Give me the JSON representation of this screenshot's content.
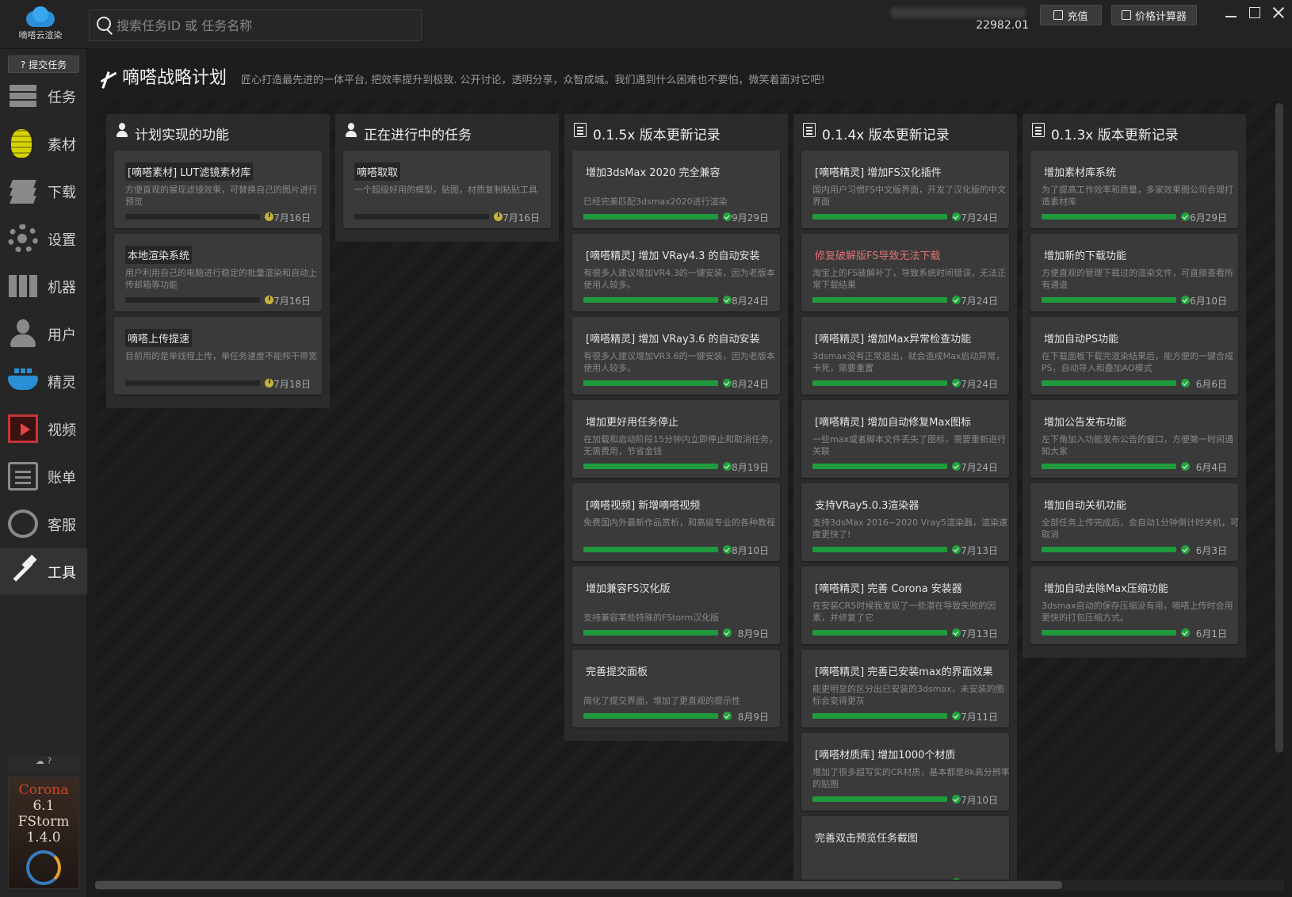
{
  "app": {
    "logo_text": "嘀嗒云渲染"
  },
  "search": {
    "placeholder": "搜索任务ID 或 任务名称"
  },
  "account": {
    "balance_suffix": "22982.01"
  },
  "toolbar": {
    "recharge": "充值",
    "calculator": "价格计算器"
  },
  "sidebar": {
    "submit": "? 提交任务",
    "items": [
      {
        "label": "任务",
        "icon": "bars-icon"
      },
      {
        "label": "素材",
        "icon": "grenade-icon"
      },
      {
        "label": "下载",
        "icon": "layers-icon"
      },
      {
        "label": "设置",
        "icon": "gear-icon"
      },
      {
        "label": "机器",
        "icon": "machine-icon"
      },
      {
        "label": "用户",
        "icon": "user-icon"
      },
      {
        "label": "精灵",
        "icon": "whale-icon"
      },
      {
        "label": "视频",
        "icon": "video-icon"
      },
      {
        "label": "账单",
        "icon": "bill-icon"
      },
      {
        "label": "客服",
        "icon": "headset-icon"
      },
      {
        "label": "工具",
        "icon": "hammer-icon",
        "active": true
      }
    ],
    "cloud_status": "☁ ?",
    "promo": {
      "line1": "Corona",
      "line2": "6.1",
      "line3": "FStorm",
      "line4": "1.4.0"
    }
  },
  "header": {
    "title": "嘀嗒战略计划",
    "subtitle": "匠心打造最先进的一体平台, 把效率提升到极致. 公开讨论，透明分享，众智成城。我们遇到什么困难也不要怕，微笑着面对它吧!"
  },
  "columns": [
    {
      "title": "计划实现的功能",
      "icon": "person-icon",
      "cards": [
        {
          "title": "[嘀嗒素材] LUT滤镜素材库",
          "tag": true,
          "desc": "方便直观的展现滤镜效果，可替换自己的图片进行预览",
          "progress": 0,
          "status": "plan",
          "date": "7月16日"
        },
        {
          "title": "本地渲染系统",
          "tag": true,
          "desc": "用户利用自己的电脑进行稳定的批量渲染和自动上传邮箱等功能",
          "progress": 0,
          "status": "plan",
          "date": "7月16日"
        },
        {
          "title": "嘀嗒上传提速",
          "tag": true,
          "desc": "目前用的是单线程上传，单任务速度不能榨干带宽",
          "progress": 0,
          "status": "plan",
          "date": "7月18日"
        }
      ]
    },
    {
      "title": "正在进行中的任务",
      "icon": "person-icon",
      "cards": [
        {
          "title": "嘀嗒取取",
          "tag": true,
          "desc": "一个超级好用的模型，贴图，材质复制粘贴工具",
          "progress": 0,
          "status": "plan",
          "date": "7月16日"
        }
      ]
    },
    {
      "title": "0.1.5x 版本更新记录",
      "icon": "doc-icon",
      "cards": [
        {
          "title": "增加3dsMax 2020 完全兼容",
          "desc": "已经完美匹配3dsmax2020进行渲染",
          "low": true,
          "progress": 100,
          "status": "done",
          "date": "9月29日"
        },
        {
          "title": "[嘀嗒精灵] 增加 VRay4.3 的自动安装",
          "desc": "有很多人建议增加VR4.3的一键安装，因为老版本使用人较多。",
          "progress": 100,
          "status": "done",
          "date": "8月24日"
        },
        {
          "title": "[嘀嗒精灵] 增加 VRay3.6 的自动安装",
          "desc": "有很多人建议增加VR3.6的一键安装，因为老版本使用人较多。",
          "progress": 100,
          "status": "done",
          "date": "8月24日"
        },
        {
          "title": "增加更好用任务停止",
          "desc": "在加载和启动阶段15分钟内立即停止和取消任务，无需费用，节省金钱",
          "progress": 100,
          "status": "done",
          "date": "8月19日"
        },
        {
          "title": "[嘀嗒视频] 新增嘀嗒视频",
          "desc": "免费国内外最新作品赏析，和高级专业的各种教程",
          "progress": 100,
          "status": "done",
          "date": "8月10日"
        },
        {
          "title": "增加兼容FS汉化版",
          "desc": "支持兼容某些特殊的FStorm汉化版",
          "low": true,
          "progress": 100,
          "status": "done",
          "date": "8月9日"
        },
        {
          "title": "完善提交面板",
          "desc": "简化了提交界面，增加了更直观的提示性",
          "low": true,
          "progress": 100,
          "status": "done",
          "date": "8月9日"
        }
      ]
    },
    {
      "title": "0.1.4x 版本更新记录",
      "icon": "doc-icon",
      "cards": [
        {
          "title": "[嘀嗒精灵] 增加FS汉化插件",
          "desc": "国内用户习惯FS中文版界面，开发了汉化版的中文界面",
          "progress": 100,
          "status": "done",
          "date": "7月24日"
        },
        {
          "title": "修复破解版FS导致无法下载",
          "red": true,
          "desc": "淘宝上的FS破解补丁，导致系统时间错误，无法正常下载结果",
          "progress": 100,
          "status": "done",
          "date": "7月24日"
        },
        {
          "title": "[嘀嗒精灵] 增加Max异常检查功能",
          "desc": "3dsmax没有正常退出，就会造成Max启动异常，卡死，需要重置",
          "progress": 100,
          "status": "done",
          "date": "7月24日"
        },
        {
          "title": "[嘀嗒精灵] 增加自动修复Max图标",
          "desc": "一些max或者脚本文件丢失了图标，需要重新进行关联",
          "progress": 100,
          "status": "done",
          "date": "7月24日"
        },
        {
          "title": "支持VRay5.0.3渲染器",
          "desc": "支持3dsMax 2016~2020 Vray5渲染器，渲染速度更快了!",
          "progress": 100,
          "status": "done",
          "date": "7月13日"
        },
        {
          "title": "[嘀嗒精灵] 完善 Corona 安装器",
          "desc": "在安装CR5时候我发现了一些潜在导致失败的因素，并修复了它",
          "progress": 100,
          "status": "done",
          "date": "7月13日"
        },
        {
          "title": "[嘀嗒精灵] 完善已安装max的界面效果",
          "desc": "能更明显的区分出已安装的3dsmax，未安装的图标会变得更灰",
          "progress": 100,
          "status": "done",
          "date": "7月11日"
        },
        {
          "title": "[嘀嗒材质库] 增加1000个材质",
          "desc": "增加了很多超写实的CR材质，基本都是8k高分辨率的贴图",
          "progress": 100,
          "status": "done",
          "date": "7月10日"
        },
        {
          "title": "完善双击预览任务截图",
          "desc": "",
          "progress": 100,
          "status": "done",
          "date": ""
        }
      ]
    },
    {
      "title": "0.1.3x 版本更新记录",
      "icon": "doc-icon",
      "cards": [
        {
          "title": "增加素材库系统",
          "desc": "为了提高工作效率和质量，多家效果图公司合理打造素材库",
          "progress": 100,
          "status": "done",
          "date": "6月29日"
        },
        {
          "title": "增加新的下载功能",
          "desc": "方便直观的管理下载过的渲染文件，可直接查看所有通道",
          "progress": 100,
          "status": "done",
          "date": "6月10日"
        },
        {
          "title": "增加自动PS功能",
          "desc": "在下载面板下载完渲染结果后，能方便的一键合成PS，自动导入和叠加AO模式",
          "progress": 100,
          "status": "done",
          "date": "6月6日"
        },
        {
          "title": "增加公告发布功能",
          "desc": "左下角加入功能发布公告的窗口，方便第一时间通知大家",
          "progress": 100,
          "status": "done",
          "date": "6月4日"
        },
        {
          "title": "增加自动关机功能",
          "desc": "全部任务上传完成后，会自动1分钟倒计时关机，可取消",
          "progress": 100,
          "status": "done",
          "date": "6月3日"
        },
        {
          "title": "增加自动去除Max压缩功能",
          "desc": "3dsmax自动的保存压缩没有用，嘀嗒上传时会用更快的打包压缩方式。",
          "progress": 100,
          "status": "done",
          "date": "6月1日"
        }
      ]
    }
  ]
}
